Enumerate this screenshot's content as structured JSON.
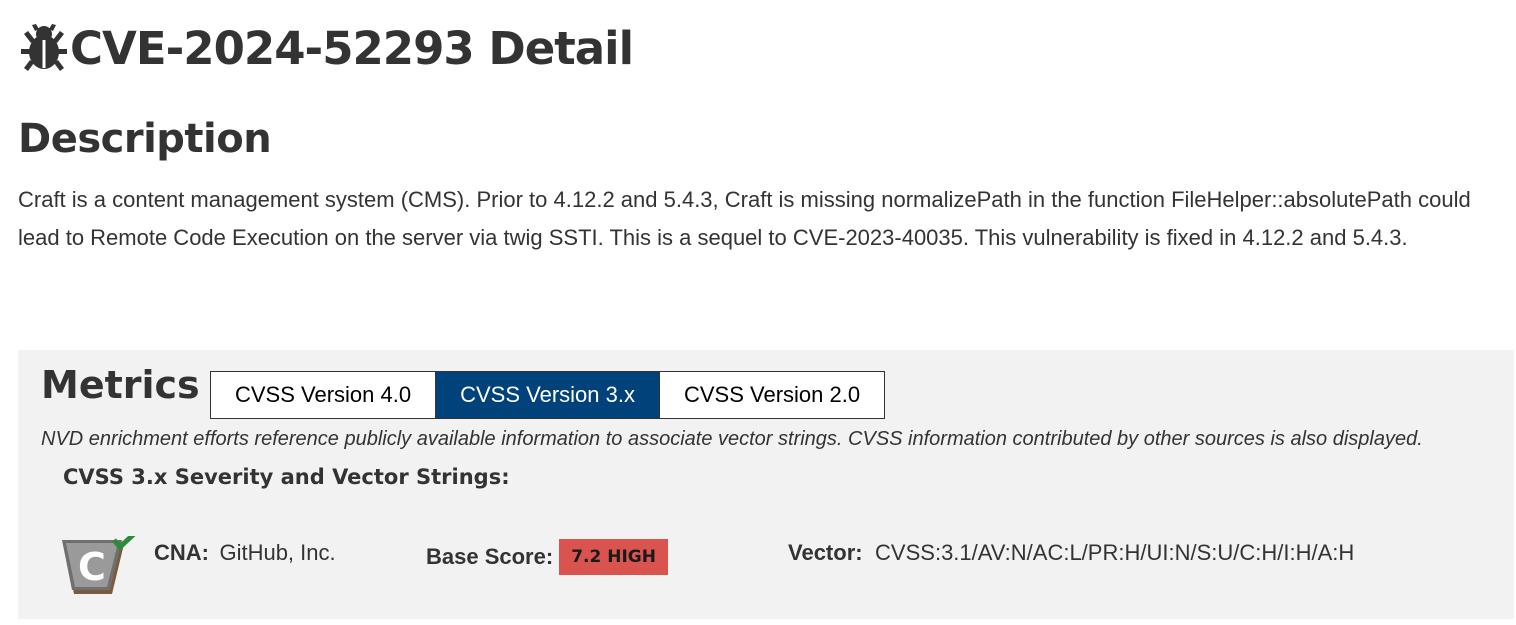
{
  "header": {
    "title": "CVE-2024-52293 Detail",
    "icon": "bug-icon"
  },
  "description": {
    "heading": "Description",
    "text": "Craft is a content management system (CMS). Prior to 4.12.2 and 5.4.3, Craft is missing normalizePath in the function FileHelper::absolutePath could lead to Remote Code Execution on the server via twig SSTI. This is a sequel to CVE-2023-40035. This vulnerability is fixed in 4.12.2 and 5.4.3."
  },
  "metrics": {
    "heading": "Metrics",
    "tabs": [
      {
        "label": "CVSS Version 4.0",
        "active": false
      },
      {
        "label": "CVSS Version 3.x",
        "active": true
      },
      {
        "label": "CVSS Version 2.0",
        "active": false
      }
    ],
    "note": "NVD enrichment efforts reference publicly available information to associate vector strings. CVSS information contributed by other sources is also displayed.",
    "severity_heading": "CVSS 3.x Severity and Vector Strings:",
    "cna": {
      "icon": "cna-shield-icon",
      "label": "CNA:",
      "value": "GitHub, Inc."
    },
    "base_score": {
      "label": "Base Score:",
      "badge": "7.2 HIGH",
      "badge_color": "#d9534f"
    },
    "vector": {
      "label": "Vector:",
      "value": "CVSS:3.1/AV:N/AC:L/PR:H/UI:N/S:U/C:H/I:H/A:H"
    }
  },
  "colors": {
    "active_tab": "#02427a",
    "panel_bg": "#f2f2f2",
    "text": "#333333"
  }
}
